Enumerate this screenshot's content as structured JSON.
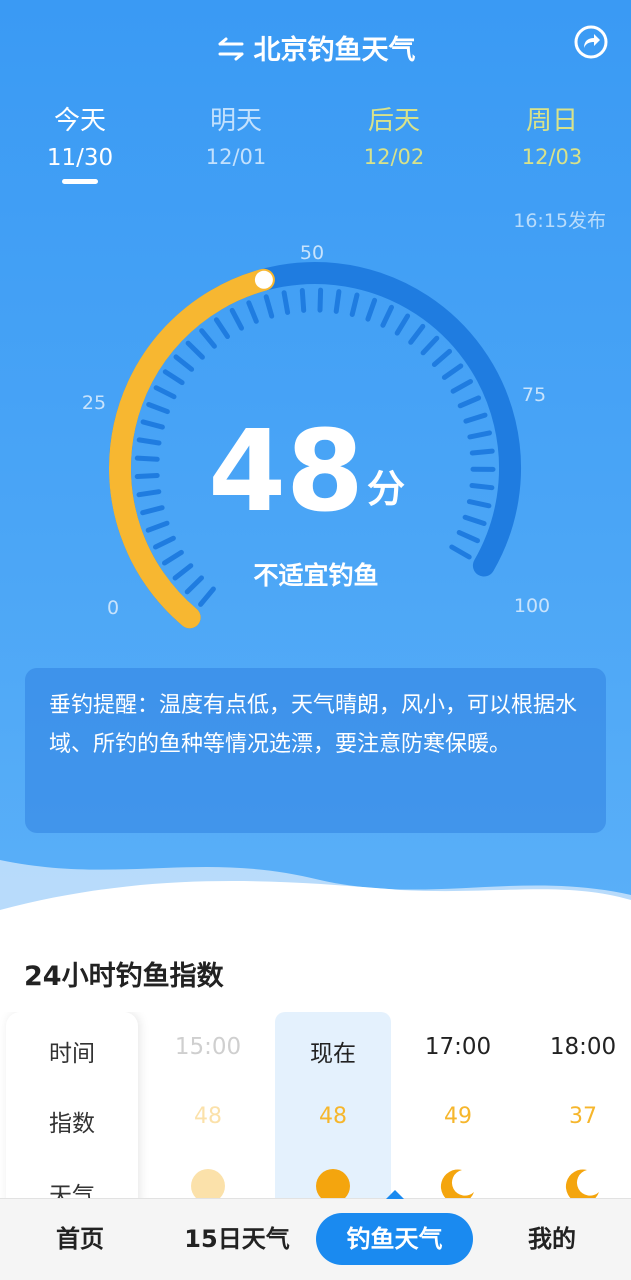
{
  "header": {
    "title": "北京钓鱼天气",
    "swap_icon": "swap-arrows-icon",
    "share_icon": "share-icon"
  },
  "day_tabs": [
    {
      "name": "今天",
      "date": "11/30",
      "active": true
    },
    {
      "name": "明天",
      "date": "12/01",
      "active": false
    },
    {
      "name": "后天",
      "date": "12/02",
      "active": false
    },
    {
      "name": "周日",
      "date": "12/03",
      "active": false
    }
  ],
  "publish_time": "16:15发布",
  "gauge": {
    "score": "48",
    "unit": "分",
    "status": "不适宜钓鱼",
    "value": 48,
    "max": 100,
    "ticks": [
      "0",
      "25",
      "50",
      "75",
      "100"
    ]
  },
  "tip": "垂钓提醒：温度有点低，天气晴朗，风小，可以根据水域、所钓的鱼种等情况选漂，要注意防寒保暖。",
  "hourly": {
    "title": "24小时钓鱼指数",
    "row_labels": [
      "时间",
      "指数",
      "天气"
    ],
    "items": [
      {
        "time": "15:00",
        "index": "48",
        "icon": "sun-icon",
        "past": true
      },
      {
        "time": "现在",
        "index": "48",
        "icon": "sun-icon",
        "current": true
      },
      {
        "time": "17:00",
        "index": "49",
        "icon": "moon-icon"
      },
      {
        "time": "18:00",
        "index": "37",
        "icon": "moon-icon"
      }
    ]
  },
  "nav": [
    {
      "label": "首页"
    },
    {
      "label": "15日天气"
    },
    {
      "label": "钓鱼天气",
      "active": true
    },
    {
      "label": "我的"
    }
  ],
  "colors": {
    "bg_blue": "#3a9af4",
    "gauge_arc": "#f7b731",
    "tab_future": "#d8e28a",
    "index_yellow": "#f6b62c",
    "nav_active": "#1a8af0"
  }
}
